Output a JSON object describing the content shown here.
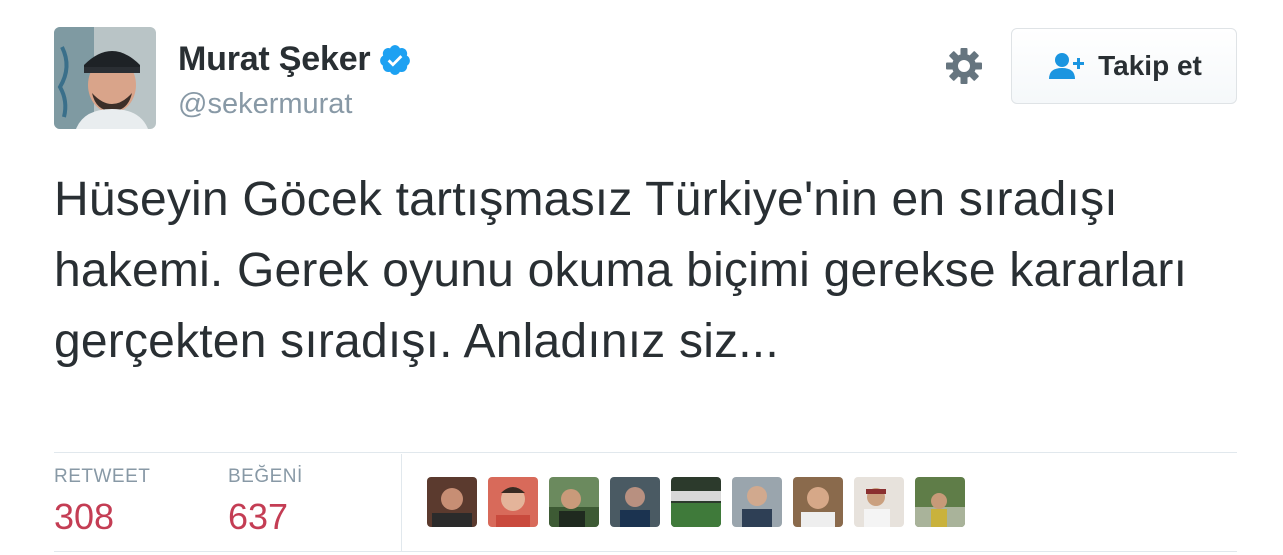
{
  "tweet": {
    "author_name": "Murat Şeker",
    "handle": "@sekermurat",
    "text": "Hüseyin Göcek tartışmasız Türkiye'nin en sıradışı hakemi. Gerek oyunu okuma biçimi gerekse kararları gerçekten sıradışı. Anladınız siz...",
    "follow_label": "Takip et",
    "verified": true
  },
  "stats": {
    "retweet_label": "RETWEET",
    "retweet_count": "308",
    "like_label": "BEĞENİ",
    "like_count": "637"
  },
  "colors": {
    "text": "#292f33",
    "muted": "#8899a6",
    "verified_blue": "#1da1f2",
    "follow_icon_blue": "#1b95e0",
    "count_red": "#c43d54"
  },
  "icons": [
    "verified-badge-icon",
    "gear-icon",
    "follow-user-plus-icon"
  ],
  "likers_count_shown": 9
}
